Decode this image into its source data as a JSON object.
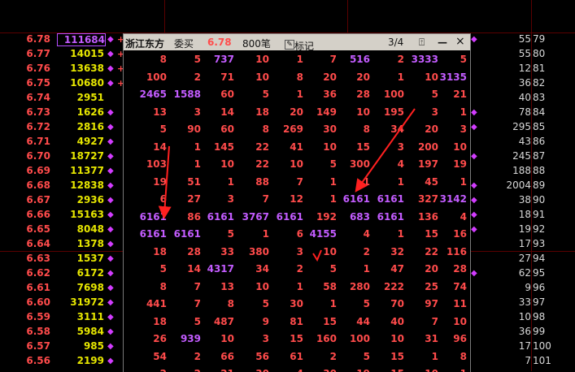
{
  "left_ladder": [
    {
      "price": "6.78",
      "vol": "111684",
      "boxed": true,
      "plus": true,
      "diamond": true
    },
    {
      "price": "6.77",
      "vol": "14015",
      "plus": true,
      "diamond": true
    },
    {
      "price": "6.76",
      "vol": "13638",
      "plus": true,
      "diamond": true
    },
    {
      "price": "6.75",
      "vol": "10680",
      "plus": true,
      "diamond": true
    },
    {
      "price": "6.74",
      "vol": "2951"
    },
    {
      "price": "6.73",
      "vol": "1626",
      "diamond": true
    },
    {
      "price": "6.72",
      "vol": "2816",
      "diamond": true
    },
    {
      "price": "6.71",
      "vol": "4927",
      "diamond": true
    },
    {
      "price": "6.70",
      "vol": "18727",
      "diamond": true
    },
    {
      "price": "6.69",
      "vol": "11377",
      "diamond": true
    },
    {
      "price": "6.68",
      "vol": "12838",
      "diamond": true
    },
    {
      "price": "6.67",
      "vol": "2936",
      "diamond": true
    },
    {
      "price": "6.66",
      "vol": "15163",
      "diamond": true
    },
    {
      "price": "6.65",
      "vol": "8048",
      "diamond": true
    },
    {
      "price": "6.64",
      "vol": "1378",
      "diamond": true
    },
    {
      "price": "6.63",
      "vol": "1537",
      "diamond": true
    },
    {
      "price": "6.62",
      "vol": "6172",
      "diamond": true
    },
    {
      "price": "6.61",
      "vol": "7698",
      "diamond": true
    },
    {
      "price": "6.60",
      "vol": "31972",
      "diamond": true
    },
    {
      "price": "6.59",
      "vol": "3111",
      "diamond": true
    },
    {
      "price": "6.58",
      "vol": "5984",
      "diamond": true
    },
    {
      "price": "6.57",
      "vol": "985",
      "diamond": true
    },
    {
      "price": "6.56",
      "vol": "2199",
      "diamond": true
    }
  ],
  "right_ladder": [
    {
      "a": "55",
      "b": "79",
      "diamond": true
    },
    {
      "a": "55",
      "b": "80"
    },
    {
      "a": "12",
      "b": "81"
    },
    {
      "a": "36",
      "b": "82"
    },
    {
      "a": "40",
      "b": "83"
    },
    {
      "a": "78",
      "b": "84",
      "diamond": true
    },
    {
      "a": "295",
      "b": "85",
      "diamond": true
    },
    {
      "a": "43",
      "b": "86"
    },
    {
      "a": "245",
      "b": "87",
      "diamond": true
    },
    {
      "a": "188",
      "b": "88"
    },
    {
      "a": "2004",
      "b": "89",
      "diamond": true
    },
    {
      "a": "38",
      "b": "90",
      "diamond": true
    },
    {
      "a": "18",
      "b": "91",
      "diamond": true
    },
    {
      "a": "19",
      "b": "92",
      "diamond": true
    },
    {
      "a": "17",
      "b": "93"
    },
    {
      "a": "27",
      "b": "94"
    },
    {
      "a": "62",
      "b": "95",
      "diamond": true
    },
    {
      "a": "9",
      "b": "96"
    },
    {
      "a": "33",
      "b": "97"
    },
    {
      "a": "10",
      "b": "98"
    },
    {
      "a": "36",
      "b": "99"
    },
    {
      "a": "17",
      "b": "100"
    },
    {
      "a": "7",
      "b": "101"
    }
  ],
  "popup": {
    "stock": "浙江东方",
    "side": "委买",
    "price": "6.78",
    "orders": "800笔",
    "mark_label": "标记",
    "page": "3/4",
    "close": "×",
    "colors": {
      "normal": "#ff4b4b",
      "big": "#c35cff",
      "title_bg": "#d4d0c8"
    },
    "rows": [
      [
        "8",
        "5",
        "737",
        "10",
        "1",
        "7",
        "516",
        "2",
        "3333",
        "5"
      ],
      [
        "100",
        "2",
        "71",
        "10",
        "8",
        "20",
        "20",
        "1",
        "10",
        "3135"
      ],
      [
        "2465",
        "1588",
        "60",
        "5",
        "1",
        "36",
        "28",
        "100",
        "5",
        "21"
      ],
      [
        "13",
        "3",
        "14",
        "18",
        "20",
        "149",
        "10",
        "195",
        "3",
        "1"
      ],
      [
        "5",
        "90",
        "60",
        "8",
        "269",
        "30",
        "8",
        "34",
        "20",
        "3"
      ],
      [
        "14",
        "1",
        "145",
        "22",
        "41",
        "10",
        "15",
        "3",
        "200",
        "10"
      ],
      [
        "103",
        "1",
        "10",
        "22",
        "10",
        "5",
        "300",
        "4",
        "197",
        "19"
      ],
      [
        "19",
        "51",
        "1",
        "88",
        "7",
        "1",
        "1",
        "1",
        "45",
        "1"
      ],
      [
        "6",
        "27",
        "3",
        "7",
        "12",
        "1",
        "6161",
        "6161",
        "327",
        "3142"
      ],
      [
        "6161",
        "86",
        "6161",
        "3767",
        "6161",
        "192",
        "683",
        "6161",
        "136",
        "4"
      ],
      [
        "6161",
        "6161",
        "5",
        "1",
        "6",
        "4155",
        "4",
        "1",
        "15",
        "16"
      ],
      [
        "18",
        "28",
        "33",
        "380",
        "3",
        "10",
        "2",
        "32",
        "22",
        "116"
      ],
      [
        "5",
        "14",
        "4317",
        "34",
        "2",
        "5",
        "1",
        "47",
        "20",
        "28"
      ],
      [
        "8",
        "7",
        "13",
        "10",
        "1",
        "58",
        "280",
        "222",
        "25",
        "74"
      ],
      [
        "441",
        "7",
        "8",
        "5",
        "30",
        "1",
        "5",
        "70",
        "97",
        "11"
      ],
      [
        "18",
        "5",
        "487",
        "9",
        "81",
        "15",
        "44",
        "40",
        "7",
        "10"
      ],
      [
        "26",
        "939",
        "10",
        "3",
        "15",
        "160",
        "100",
        "10",
        "31",
        "96"
      ],
      [
        "54",
        "2",
        "66",
        "56",
        "61",
        "2",
        "5",
        "15",
        "1",
        "8"
      ],
      [
        "2",
        "2",
        "21",
        "30",
        "4",
        "30",
        "19",
        "15",
        "10",
        "1"
      ]
    ]
  }
}
